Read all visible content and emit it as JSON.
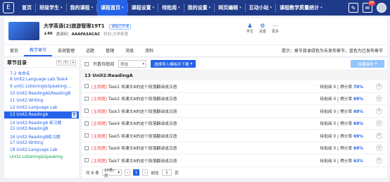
{
  "nav": {
    "logo_icon": "E",
    "items": [
      {
        "label": "首页",
        "active": false,
        "caret": false
      },
      {
        "label": "班级学生",
        "active": false,
        "caret": true
      },
      {
        "label": "我的课程",
        "active": false,
        "caret": true
      },
      {
        "label": "课程首页",
        "active": true,
        "caret": true
      },
      {
        "label": "课程设置",
        "active": false,
        "caret": true
      },
      {
        "label": "待批阅",
        "active": false,
        "caret": true
      },
      {
        "label": "我的设置",
        "active": false,
        "caret": true
      },
      {
        "label": "网页编辑",
        "active": false,
        "caret": true
      },
      {
        "label": "互动小站",
        "active": false,
        "caret": true
      },
      {
        "label": "课程教学质量统计",
        "active": false,
        "caret": true
      }
    ],
    "tools": [
      {
        "name": "edit-icon",
        "glyph": "✎",
        "badge": ""
      },
      {
        "name": "mail-icon",
        "glyph": "✉",
        "badge": "24"
      }
    ]
  },
  "course": {
    "title": "大学英语(2)旅游管理19T1",
    "status_tag": "课程已开课",
    "student_count": "46",
    "code_label": "邀请码：",
    "code": "AAAFA3ACAC",
    "subject_label": "科目:",
    "subject": "大学英语",
    "actions": [
      {
        "label": "学生",
        "icon": "person-icon",
        "glyph": "♟"
      },
      {
        "label": "设置",
        "icon": "gear-icon",
        "glyph": "⚙"
      },
      {
        "label": "更多",
        "icon": "more-icon",
        "glyph": "⋯"
      }
    ]
  },
  "tabs": [
    "首页",
    "教学章节",
    "自测管理",
    "话题",
    "管辖",
    "消息",
    "资料"
  ],
  "active_tab": 1,
  "hint": "提示：章节目录绿色为未发布章节，蓝色为已发布章节",
  "sidebar": {
    "title": "章节目录",
    "items": [
      {
        "label": "7-2 未命名",
        "state": "normal"
      },
      {
        "label": "8 Unit2:Language Lab:Task4",
        "state": "normal"
      },
      {
        "label": "9 unit1:Listening&Speaking:...",
        "state": "normal"
      },
      {
        "label": "10 Unit2:ReadingA&ReadingB",
        "state": "normal"
      },
      {
        "label": "11 Unit2:Writing",
        "state": "normal"
      },
      {
        "label": "12 Unit2:Language Lab",
        "state": "normal"
      },
      {
        "label": "13 Unit2:ReadingA",
        "state": "selected"
      },
      {
        "label": "14 Unit2:ReadingA 练习题",
        "state": "normal"
      },
      {
        "label": "15 Unit2:ReadingB",
        "state": "normal"
      },
      {
        "label": "16 Unit2:ReadingB练习题",
        "state": "normal"
      },
      {
        "label": "17 Unit2:Writing",
        "state": "normal"
      },
      {
        "label": "18 Unit2:Language Lab",
        "state": "normal"
      },
      {
        "label": "Unit2:Listening&Speaking",
        "state": "unpublished"
      }
    ]
  },
  "toolbar": {
    "only_pending": "只看待批阅",
    "filter_label": "筛选",
    "import_button": "选择导入模板并下载",
    "batch_button": "批量操作"
  },
  "chapter_title": "13 Unit2:ReadingA",
  "tasks": [
    {
      "type": "[主观题]",
      "name": "Task1 将课文A的这个段落翻译成汉语",
      "pending": "待批阅",
      "count": "0",
      "score_label": "得分率",
      "score": "70%"
    },
    {
      "type": "[主观题]",
      "name": "Task2 将课文A的这个段落翻译成汉语",
      "pending": "待批阅",
      "count": "0",
      "score_label": "得分率",
      "score": "69%"
    },
    {
      "type": "[主观题]",
      "name": "Task3 将课文A的这个段落翻译成汉语",
      "pending": "待批阅",
      "count": "0",
      "score_label": "得分率",
      "score": "69%"
    },
    {
      "type": "[主观题]",
      "name": "Task4 将课文A的这个段落翻译成汉语",
      "pending": "待批阅",
      "count": "0",
      "score_label": "得分率",
      "score": "69%"
    },
    {
      "type": "[主观题]",
      "name": "Task5 将课文A的这个段落翻译成汉语",
      "pending": "待批阅",
      "count": "0",
      "score_label": "得分率",
      "score": "69%"
    },
    {
      "type": "[主观题]",
      "name": "Task6 将课文A的这个段落翻译成汉语",
      "pending": "待批阅",
      "count": "0",
      "score_label": "得分率",
      "score": "69%"
    },
    {
      "type": "[主观题]",
      "name": "Task7 将课文A的这个段落翻译成汉语",
      "pending": "待批阅",
      "count": "0",
      "score_label": "得分率",
      "score": "63%"
    }
  ],
  "pager": {
    "total": "共 6 条",
    "page_size": "20条/页",
    "current": "1",
    "goto_label": "前往",
    "goto_value": "1",
    "page_unit": "页"
  }
}
